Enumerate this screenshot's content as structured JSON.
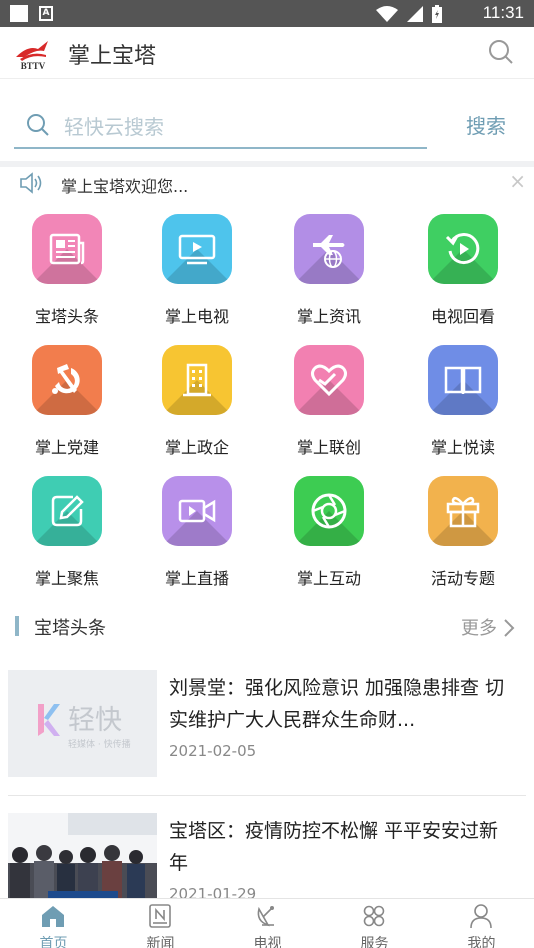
{
  "status_bar": {
    "time": "11:31"
  },
  "app_bar": {
    "logo_text": "BTTV",
    "title": "掌上宝塔"
  },
  "search": {
    "placeholder": "轻快云搜索",
    "button": "搜索"
  },
  "notice": {
    "text": "掌上宝塔欢迎您..."
  },
  "grid": [
    {
      "label": "宝塔头条",
      "icon": "newspaper-icon",
      "color": "#f286b7"
    },
    {
      "label": "掌上电视",
      "icon": "tv-icon",
      "color": "#4ec4ec"
    },
    {
      "label": "掌上资讯",
      "icon": "plane-globe-icon",
      "color": "#b28ee6"
    },
    {
      "label": "电视回看",
      "icon": "replay-icon",
      "color": "#3fcf62"
    },
    {
      "label": "掌上党建",
      "icon": "hammer-sickle-icon",
      "color": "#f27d4d"
    },
    {
      "label": "掌上政企",
      "icon": "building-icon",
      "color": "#f7c532"
    },
    {
      "label": "掌上联创",
      "icon": "heart-hand-icon",
      "color": "#f280b1"
    },
    {
      "label": "掌上悦读",
      "icon": "book-icon",
      "color": "#6f8de6"
    },
    {
      "label": "掌上聚焦",
      "icon": "edit-icon",
      "color": "#3fcdb3"
    },
    {
      "label": "掌上直播",
      "icon": "video-camera-icon",
      "color": "#b890ea"
    },
    {
      "label": "掌上互动",
      "icon": "aperture-icon",
      "color": "#3dcc52"
    },
    {
      "label": "活动专题",
      "icon": "gift-icon",
      "color": "#f2b24d"
    }
  ],
  "section": {
    "title": "宝塔头条",
    "more": "更多"
  },
  "news": [
    {
      "headline": "刘景堂：强化风险意识 加强隐患排查 切实维护广大人民群众生命财...",
      "date": "2021-02-05",
      "thumb_brand": "轻快",
      "thumb_sub": "轻媒体 · 快传播"
    },
    {
      "headline": "宝塔区：疫情防控不松懈 平平安安过新年",
      "date": "2021-01-29"
    }
  ],
  "tabs": [
    {
      "label": "首页",
      "icon": "home-icon",
      "active": true
    },
    {
      "label": "新闻",
      "icon": "news-icon"
    },
    {
      "label": "电视",
      "icon": "satellite-dish-icon"
    },
    {
      "label": "服务",
      "icon": "services-icon"
    },
    {
      "label": "我的",
      "icon": "user-icon"
    }
  ],
  "colors": {
    "accent": "#6f9db3",
    "status_bar": "#555555"
  }
}
